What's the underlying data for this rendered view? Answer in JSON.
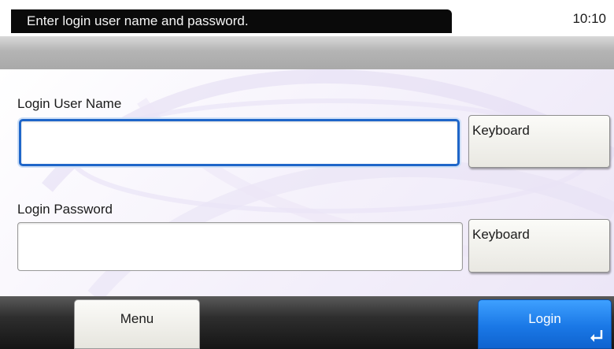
{
  "status": {
    "message": "Enter login user name and password.",
    "time": "10:10"
  },
  "form": {
    "username_label": "Login User Name",
    "username_value": "",
    "password_label": "Login Password",
    "password_value": "",
    "keyboard_label": "Keyboard"
  },
  "footer": {
    "menu_label": "Menu",
    "login_label": "Login"
  },
  "colors": {
    "accent": "#1f66c9",
    "login_button": "#1a78e6",
    "status_bar": "#0a0a0a"
  },
  "icons": {
    "login": "enter-return-icon"
  }
}
